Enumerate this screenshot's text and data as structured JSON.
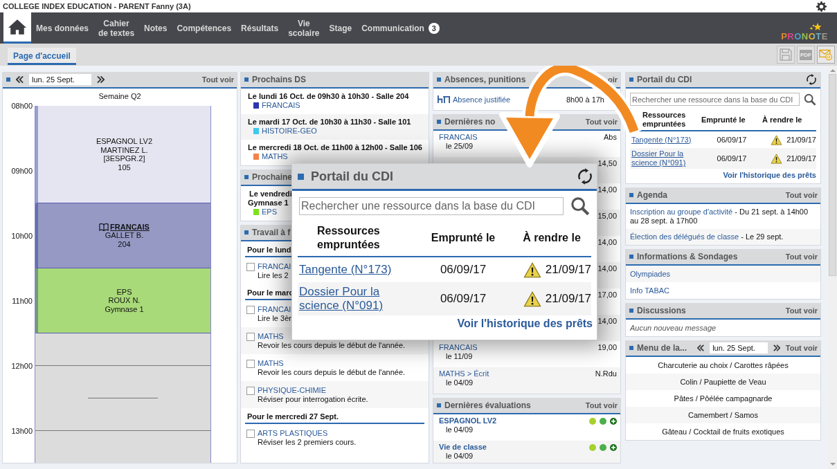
{
  "window": {
    "title": "COLLEGE INDEX EDUCATION - PARENT Fanny (3A)"
  },
  "nav": {
    "items": [
      {
        "kind": "home",
        "selected": true
      },
      {
        "kind": "text",
        "label": "Mes données",
        "selected": false
      },
      {
        "kind": "text",
        "label": "Cahier\nde textes",
        "selected": false
      },
      {
        "kind": "text",
        "label": "Notes",
        "selected": false
      },
      {
        "kind": "text",
        "label": "Compétences",
        "selected": false
      },
      {
        "kind": "text",
        "label": "Résultats",
        "selected": false
      },
      {
        "kind": "text",
        "label": "Vie\nscolaire",
        "selected": false
      },
      {
        "kind": "text",
        "label": "Stage",
        "selected": false
      },
      {
        "kind": "text",
        "label": "Communication",
        "badge": "3",
        "selected": false
      }
    ],
    "logo": "PRONOTE"
  },
  "tabs": [
    {
      "label": "Page d'accueil",
      "selected": true
    }
  ],
  "toolbar": [
    {
      "kind": "save",
      "disabled": true
    },
    {
      "kind": "pdf",
      "label": "PDF",
      "disabled": true
    },
    {
      "kind": "mail",
      "disabled": false
    }
  ],
  "timetable": {
    "date": "lun. 25 Sept.",
    "action": "Tout voir",
    "week": "Semaine Q2",
    "hours": [
      "08h00",
      "09h00",
      "10h00",
      "11h00",
      "12h00",
      "13h00"
    ],
    "courses": [
      {
        "lines": [
          "ESPAGNOL LV2",
          "MARTINEZ L.",
          "[3ESPGR.2]",
          "105"
        ],
        "color": "#e5e5f1",
        "homework": false
      },
      {
        "lines": [
          "FRANCAIS",
          "GALLET B.",
          "204"
        ],
        "color": "#9599c4",
        "homework": true
      },
      {
        "lines": [
          "EPS",
          "ROUX N.",
          "Gymnase 1"
        ],
        "color": "#a9da79",
        "homework": false
      }
    ]
  },
  "ds": {
    "title": "Prochains DS",
    "items": [
      {
        "when": "Le lundi 16 Oct. de 09h30 à 10h30 - Salle 204",
        "subject": "FRANCAIS",
        "color": "#2b35ad"
      },
      {
        "when": "Le mardi 17 Oct. de 10h30 à 11h30 - Salle 101",
        "subject": "HISTOIRE-GEO",
        "color": "#3fc9ef"
      },
      {
        "when": "Le mercredi 18 Oct. de 11h00 à 12h00 - Salle 106",
        "subject": "MATHS",
        "color": "#f3834a"
      }
    ]
  },
  "events": {
    "title": "Prochaine",
    "items": [
      {
        "when": "Le vendredi",
        "place": "Gymnase 1",
        "subject": "EPS",
        "color": "#7fe01c"
      }
    ]
  },
  "homework": {
    "title": "Travail à f",
    "groups": [
      {
        "heading": "Pour le lund",
        "items": [
          {
            "subject": "FRANCAI",
            "text": "Lire les 2",
            "done": false
          }
        ]
      },
      {
        "heading": "Pour le marc",
        "items": [
          {
            "subject": "FRANCAI",
            "text": "Lire le 3èr",
            "done": false
          },
          {
            "subject": "MATHS",
            "text": "Revoir les cours depuis le début de l'année.",
            "done": false
          },
          {
            "subject": "MATHS",
            "text": "Revoir les cours depuis le début de l'année.",
            "done": false
          },
          {
            "subject": "PHYSIQUE-CHIMIE",
            "text": "Réviser pour interrogation écrite.",
            "done": false
          }
        ]
      },
      {
        "heading": "Pour le mercredi 27 Sept.",
        "items": [
          {
            "subject": "ARTS PLASTIQUES",
            "text": "Réviser les 2 premiers cours.",
            "done": false
          }
        ]
      }
    ]
  },
  "absences": {
    "title": "Absences, punitions",
    "action": "oir",
    "items": [
      {
        "label": "Absence justifiée",
        "detail": "8h00 à 17h"
      }
    ]
  },
  "grades": {
    "title": "Dernières no",
    "action": "Tout voir",
    "items": [
      {
        "subject": "FRANCAIS",
        "date": "le 25/09",
        "value": "Abs"
      },
      {
        "value": "14,50"
      },
      {
        "value": "14,00"
      },
      {
        "value": "15,00"
      },
      {
        "value": "14,00"
      },
      {
        "value": "14,00"
      },
      {
        "value": "17,00"
      },
      {
        "value": "14,00"
      },
      {
        "subject": "FRANCAIS",
        "date": "le 11/09",
        "value": "19,00"
      },
      {
        "subject": "MATHS > Écrit",
        "date": "le 04/09",
        "value": "N.Rdu"
      }
    ]
  },
  "evaluations": {
    "title": "Dernières évaluations",
    "action": "Tout voir",
    "items": [
      {
        "subject": "ESPAGNOL LV2",
        "date": "le 04/09",
        "levels": [
          {
            "color": "#a6d12e"
          },
          {
            "color": "#4caf4c"
          }
        ]
      },
      {
        "subject": "Vie de classe",
        "date": "le 04/09",
        "levels": [
          {
            "color": "#a6d12e"
          },
          {
            "color": "#4caf4c"
          }
        ]
      }
    ]
  },
  "cdi": {
    "title": "Portail du CDI",
    "placeholder": "Rechercher une ressource dans la base du CDI",
    "columns": [
      "Ressources\nempruntées",
      "Emprunté le",
      "À rendre le"
    ],
    "rows": [
      {
        "title": "Tangente (N°173)",
        "borrowed": "06/09/17",
        "due": "21/09/17",
        "overdue": true
      },
      {
        "title": "Dossier Pour la science (N°091)",
        "borrowed": "06/09/17",
        "due": "21/09/17",
        "overdue": true
      }
    ],
    "history": "Voir l'historique des prêts"
  },
  "agenda": {
    "title": "Agenda",
    "action": "Tout voir",
    "items": [
      {
        "link": "Inscription au groupe d'activité",
        "detail": " - Du 21 sept. à 14h00 au 28 sept. à 17h00"
      },
      {
        "link": "Élection des délégués de classe",
        "detail": " - Le 29 sept."
      }
    ]
  },
  "info": {
    "title": "Informations & Sondages",
    "action": "Tout voir",
    "items": [
      "Olympiades",
      "Info TABAC"
    ]
  },
  "discussions": {
    "title": "Discussions",
    "action": "Tout voir",
    "empty": "Aucun nouveau message"
  },
  "menu": {
    "title": "Menu de la...",
    "date": "lun. 25 Sept.",
    "action": "Tout voir",
    "items": [
      "Charcuterie au choix / Carottes râpées",
      "Colin / Paupiette de Veau",
      "Pâtes / Pôélée campagnarde",
      "Camembert / Samos",
      "Gâteau / Cocktail de fruits exotiques"
    ]
  },
  "cdi_popup": {
    "title": "Portail du CDI",
    "placeholder": "Rechercher une ressource dans la base du CDI",
    "columns": [
      "Ressources\nempruntées",
      "Emprunté le",
      "À rendre le"
    ],
    "rows": [
      {
        "title": "Tangente (N°173)",
        "borrowed": "06/09/17",
        "due": "21/09/17",
        "overdue": true
      },
      {
        "title": "Dossier Pour la\nscience (N°091)",
        "borrowed": "06/09/17",
        "due": "21/09/17",
        "overdue": true
      }
    ],
    "history": "Voir l'historique des prêts"
  }
}
